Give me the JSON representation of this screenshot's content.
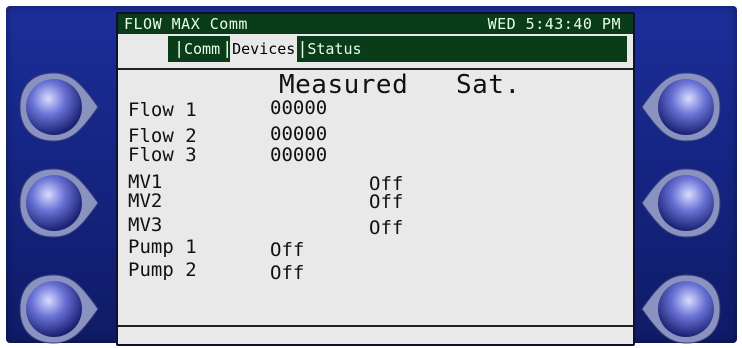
{
  "header": {
    "app_title": "FLOW MAX Comm",
    "clock": "WED 5:43:40 PM"
  },
  "tabs": [
    {
      "label": "Comm",
      "active": false
    },
    {
      "label": "Devices",
      "active": true
    },
    {
      "label": "Status",
      "active": false
    }
  ],
  "columns": {
    "measured": "Measured",
    "sat": "Sat."
  },
  "rows": [
    {
      "label": "Flow 1",
      "measured": "00000",
      "sat": ""
    },
    {
      "label": "Flow 2",
      "measured": "00000",
      "sat": ""
    },
    {
      "label": "Flow 3",
      "measured": "00000",
      "sat": ""
    },
    {
      "label": "MV1",
      "measured": "",
      "sat": "Off"
    },
    {
      "label": "MV2",
      "measured": "",
      "sat": "Off"
    },
    {
      "label": "MV3",
      "measured": "",
      "sat": "Off"
    },
    {
      "label": "Pump 1",
      "measured": "Off",
      "sat": ""
    },
    {
      "label": "Pump 2",
      "measured": "Off",
      "sat": ""
    }
  ],
  "side_buttons": {
    "left": [
      "left-soft-button-1",
      "left-soft-button-2",
      "left-soft-button-3"
    ],
    "right": [
      "right-soft-button-1",
      "right-soft-button-2",
      "right-soft-button-3"
    ]
  },
  "colors": {
    "bezel": "#1c2e9a",
    "screen": "#e9e9e9",
    "title_bar": "#0a3c1a",
    "title_text": "#e6ffe6"
  }
}
